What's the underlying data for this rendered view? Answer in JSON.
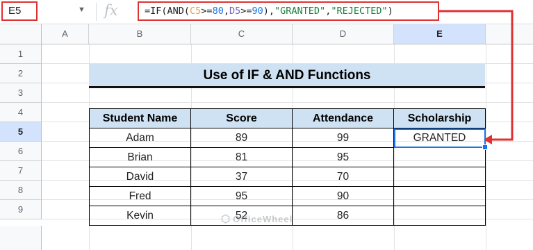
{
  "formula_bar": {
    "name_box": "E5",
    "dropdown_icon": "▼",
    "fx_icon": "fx",
    "formula_parts": [
      {
        "text": "=IF(AND(",
        "kind": "plain"
      },
      {
        "text": "C5",
        "kind": "ref1"
      },
      {
        "text": ">=",
        "kind": "plain"
      },
      {
        "text": "80",
        "kind": "num"
      },
      {
        "text": ",",
        "kind": "plain"
      },
      {
        "text": "D5",
        "kind": "ref2"
      },
      {
        "text": ">=",
        "kind": "plain"
      },
      {
        "text": "90",
        "kind": "num"
      },
      {
        "text": "),",
        "kind": "plain"
      },
      {
        "text": "\"GRANTED\"",
        "kind": "str"
      },
      {
        "text": ",",
        "kind": "plain"
      },
      {
        "text": "\"REJECTED\"",
        "kind": "str"
      },
      {
        "text": ")",
        "kind": "plain"
      }
    ]
  },
  "columns": [
    "A",
    "B",
    "C",
    "D",
    "E"
  ],
  "rows": [
    "1",
    "2",
    "3",
    "4",
    "5",
    "6",
    "7",
    "8",
    "9"
  ],
  "active_cell": {
    "column": "E",
    "row": "5"
  },
  "title": "Use of IF & AND Functions",
  "table": {
    "headers": {
      "name": "Student Name",
      "score": "Score",
      "attendance": "Attendance",
      "scholarship": "Scholarship"
    },
    "rows": [
      {
        "name": "Adam",
        "score": "89",
        "attendance": "99",
        "scholarship": "GRANTED"
      },
      {
        "name": "Brian",
        "score": "81",
        "attendance": "95",
        "scholarship": ""
      },
      {
        "name": "David",
        "score": "37",
        "attendance": "70",
        "scholarship": ""
      },
      {
        "name": "Fred",
        "score": "95",
        "attendance": "90",
        "scholarship": ""
      },
      {
        "name": "Kevin",
        "score": "52",
        "attendance": "86",
        "scholarship": ""
      }
    ]
  },
  "watermark": {
    "text": "OfficeWheel",
    "icon": "⬡"
  },
  "colors": {
    "highlight": "#e03131",
    "selection": "#1a73e8",
    "header_fill": "#cfe2f3"
  }
}
